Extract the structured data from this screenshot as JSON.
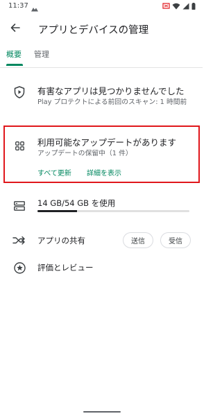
{
  "status_bar": {
    "time": "11:37",
    "left_icon": "cloud-upload-icon",
    "right_icons": [
      "cast-icon",
      "wifi-icon",
      "signal-icon",
      "battery-icon"
    ]
  },
  "app_bar": {
    "back_icon": "arrow-back-icon",
    "title": "アプリとデバイスの管理"
  },
  "tabs": [
    {
      "label": "概要",
      "selected": true
    },
    {
      "label": "管理",
      "selected": false
    }
  ],
  "protect": {
    "icon": "play-protect-icon",
    "title": "有害なアプリは見つかりませんでした",
    "subtitle": "Play プロテクトによる前回のスキャン: 1 時間前"
  },
  "updates": {
    "icon": "apps-grid-icon",
    "title": "利用可能なアップデートがあります",
    "subtitle": "アップデートの保留中（1 件）",
    "update_all_label": "すべて更新",
    "details_label": "詳細を表示"
  },
  "storage": {
    "icon": "storage-icon",
    "label": "14 GB/54 GB を使用",
    "used_fraction": 0.259
  },
  "share": {
    "icon": "share-apps-icon",
    "label": "アプリの共有",
    "send_label": "送信",
    "receive_label": "受信"
  },
  "ratings": {
    "icon": "star-badge-icon",
    "label": "評価とレビュー"
  },
  "colors": {
    "accent": "#01875f",
    "highlight_border": "#e0161b",
    "text_primary": "#202124",
    "text_secondary": "#5f6368"
  }
}
